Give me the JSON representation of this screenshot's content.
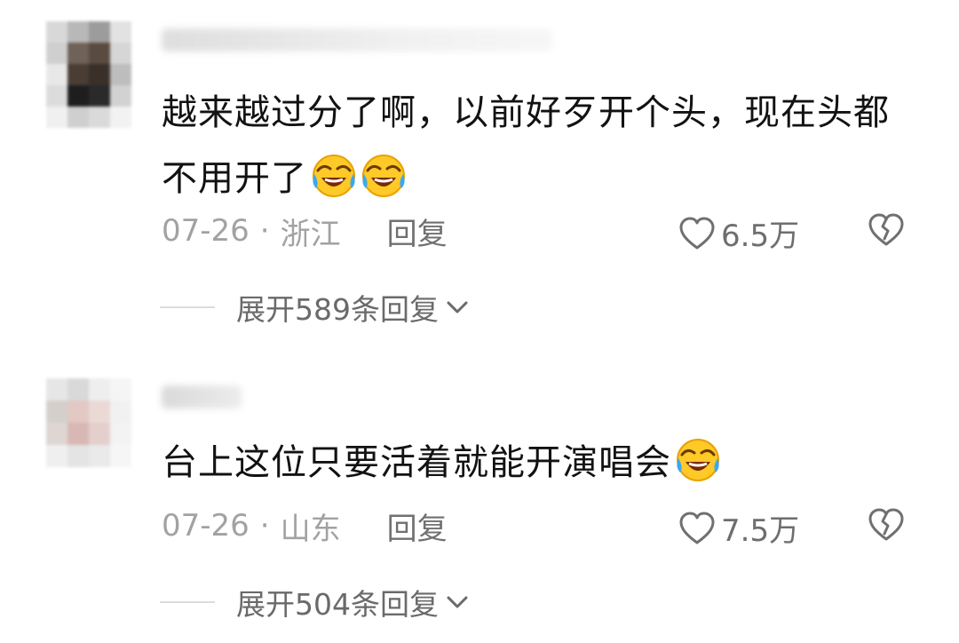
{
  "comments": [
    {
      "text": "越来越过分了啊，以前好歹开个头，现在头都不用开了",
      "emojis": [
        "grinning-tears-emoji",
        "grinning-tears-emoji"
      ],
      "date": "07-26",
      "separator": "·",
      "location": "浙江",
      "reply_label": "回复",
      "likes": "6.5万",
      "expand_label": "展开589条回复"
    },
    {
      "text": "台上这位只要活着就能开演唱会",
      "emojis": [
        "grinning-tears-emoji"
      ],
      "date": "07-26",
      "separator": "·",
      "location": "山东",
      "reply_label": "回复",
      "likes": "7.5万",
      "expand_label": "展开504条回复"
    }
  ],
  "icons": {
    "like": "heart-outline-icon",
    "dislike": "broken-heart-outline-icon",
    "expand": "chevron-down-icon"
  },
  "colors": {
    "text": "#121212",
    "meta": "#a2a2a2",
    "icon": "#707070",
    "emoji_yellow": "#ffc928"
  }
}
